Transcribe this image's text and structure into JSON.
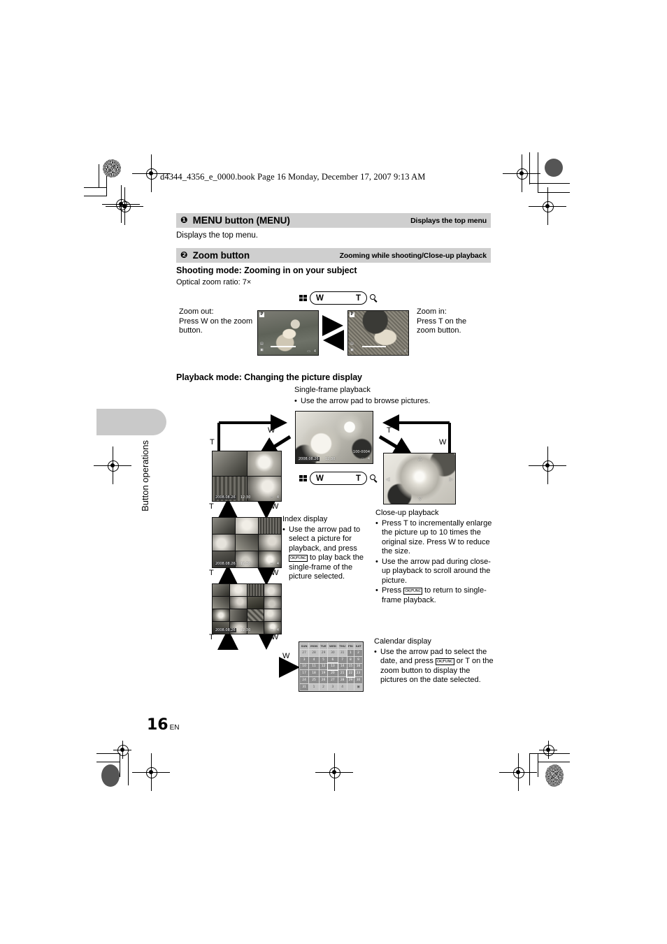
{
  "print_header": "d4344_4356_e_0000.book  Page 16  Monday, December 17, 2007  9:13 AM",
  "sections": [
    {
      "number": "❶",
      "title_bold": "MENU",
      "title_rest": " button (MENU)",
      "right_label": "Displays the top menu",
      "body": "Displays the top menu."
    },
    {
      "number": "❷",
      "title_bold": "Zoom button",
      "title_rest": "",
      "right_label": "Zooming while shooting/Close-up playback"
    }
  ],
  "shooting": {
    "heading": "Shooting mode: Zooming in on your subject",
    "optical": "Optical zoom ratio: 7×",
    "zoom_out_lines": [
      "Zoom out:",
      "Press W on the zoom",
      "button."
    ],
    "zoom_in_lines": [
      "Zoom in:",
      "Press T on the",
      "zoom button."
    ]
  },
  "lever": {
    "wide": "W",
    "tele": "T",
    "index_icon": "index-grid-icon",
    "magnifier_icon": "magnifier-icon"
  },
  "playback": {
    "heading": "Playback mode: Changing the picture display",
    "single_frame_title": "Single-frame playback",
    "single_frame_bullet": "Use the arrow pad to browse pictures.",
    "labels": {
      "w": "W",
      "t": "T"
    },
    "index": {
      "title": "Index display",
      "bullets": [
        "Use the arrow pad to select a picture for playback, and press OK/FUNC to play back the single-frame of the picture selected."
      ],
      "bullet_parts": [
        "Use the arrow pad to",
        "select a picture for",
        "playback, and press",
        "to play back the single-",
        "frame of the picture",
        "selected."
      ],
      "okfunc": "OK/FUNC"
    },
    "closeup": {
      "title": "Close-up playback",
      "bullets": [
        "Press T to incrementally enlarge the picture up to 10 times the original size. Press W to reduce the size.",
        "Use the arrow pad during close-up playback to scroll around the picture.",
        "Press OK/FUNC to return to single-frame playback."
      ],
      "okfunc": "OK/FUNC"
    },
    "calendar": {
      "title": "Calendar display",
      "bullets": [
        "Use the arrow pad to select the date, and press OK/FUNC or T on the zoom button to display the pictures on the date selected."
      ],
      "okfunc": "OK/FUNC"
    }
  },
  "lcd_osd": {
    "date": "2008.08.26",
    "time": "12:30",
    "file_no": "100-0004",
    "battery_count": "4",
    "mode_icon": "P"
  },
  "calendar_data": {
    "weekdays": [
      "SUN",
      "MON",
      "TUE",
      "WED",
      "THU",
      "FRI",
      "SAT"
    ],
    "rows": [
      [
        "27",
        "28",
        "29",
        "30",
        "31",
        "1",
        "2"
      ],
      [
        "3",
        "4",
        "5",
        "6",
        "7",
        "8",
        "9"
      ],
      [
        "10",
        "11",
        "12",
        "13",
        "14",
        "15",
        "16"
      ],
      [
        "17",
        "18",
        "19",
        "20",
        "21",
        "22",
        "23"
      ],
      [
        "24",
        "25",
        "26",
        "27",
        "28",
        "29",
        "30"
      ],
      [
        "31",
        "1",
        "2",
        "3",
        "4",
        "",
        ""
      ]
    ],
    "selected": "26"
  },
  "sidebar_tab_label": "Button operations",
  "page_number": "16",
  "page_lang": "EN"
}
